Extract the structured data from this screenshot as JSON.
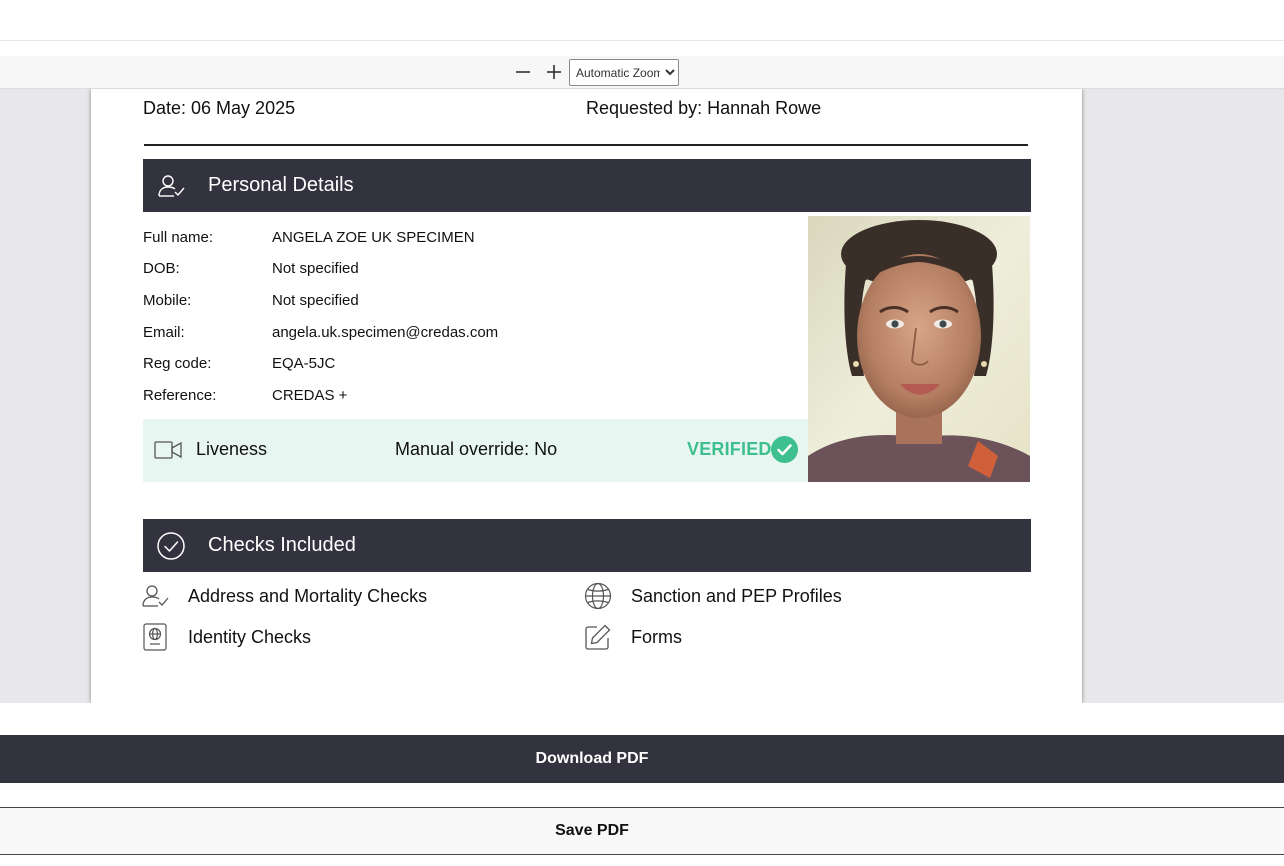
{
  "toolbar": {
    "zoom_out_icon": "minus-icon",
    "zoom_in_icon": "plus-icon",
    "zoom_selected": "Automatic Zoom"
  },
  "report": {
    "date": "Date: 06 May 2025",
    "requested_by": "Requested by: Hannah Rowe"
  },
  "personal_details": {
    "title": "Personal Details",
    "icon": "user-check-icon",
    "rows": [
      {
        "label": "Full name:",
        "value": "ANGELA ZOE UK SPECIMEN"
      },
      {
        "label": "DOB:",
        "value": "Not specified"
      },
      {
        "label": "Mobile:",
        "value": "Not specified"
      },
      {
        "label": "Email:",
        "value": "angela.uk.specimen@credas.com"
      },
      {
        "label": "Reg code:",
        "value": "EQA-5JC"
      },
      {
        "label": "Reference:",
        "value": "CREDAS +"
      }
    ]
  },
  "liveness": {
    "icon": "video-camera-icon",
    "label": "Liveness",
    "override": "Manual override: No",
    "status": "VERIFIED",
    "status_color": "#3dbf8f"
  },
  "checks": {
    "title": "Checks Included",
    "icon": "check-circle-icon",
    "items": [
      {
        "label": "Address and Mortality Checks",
        "icon": "user-check-icon"
      },
      {
        "label": "Sanction and PEP Profiles",
        "icon": "globe-icon"
      },
      {
        "label": "Identity Checks",
        "icon": "passport-icon"
      },
      {
        "label": "Forms",
        "icon": "edit-icon"
      }
    ]
  },
  "actions": {
    "download": "Download PDF",
    "save": "Save PDF"
  },
  "colors": {
    "header_bar": "#33323f",
    "liveness_bg": "#e7f6f1",
    "verified": "#3dbf8f"
  }
}
